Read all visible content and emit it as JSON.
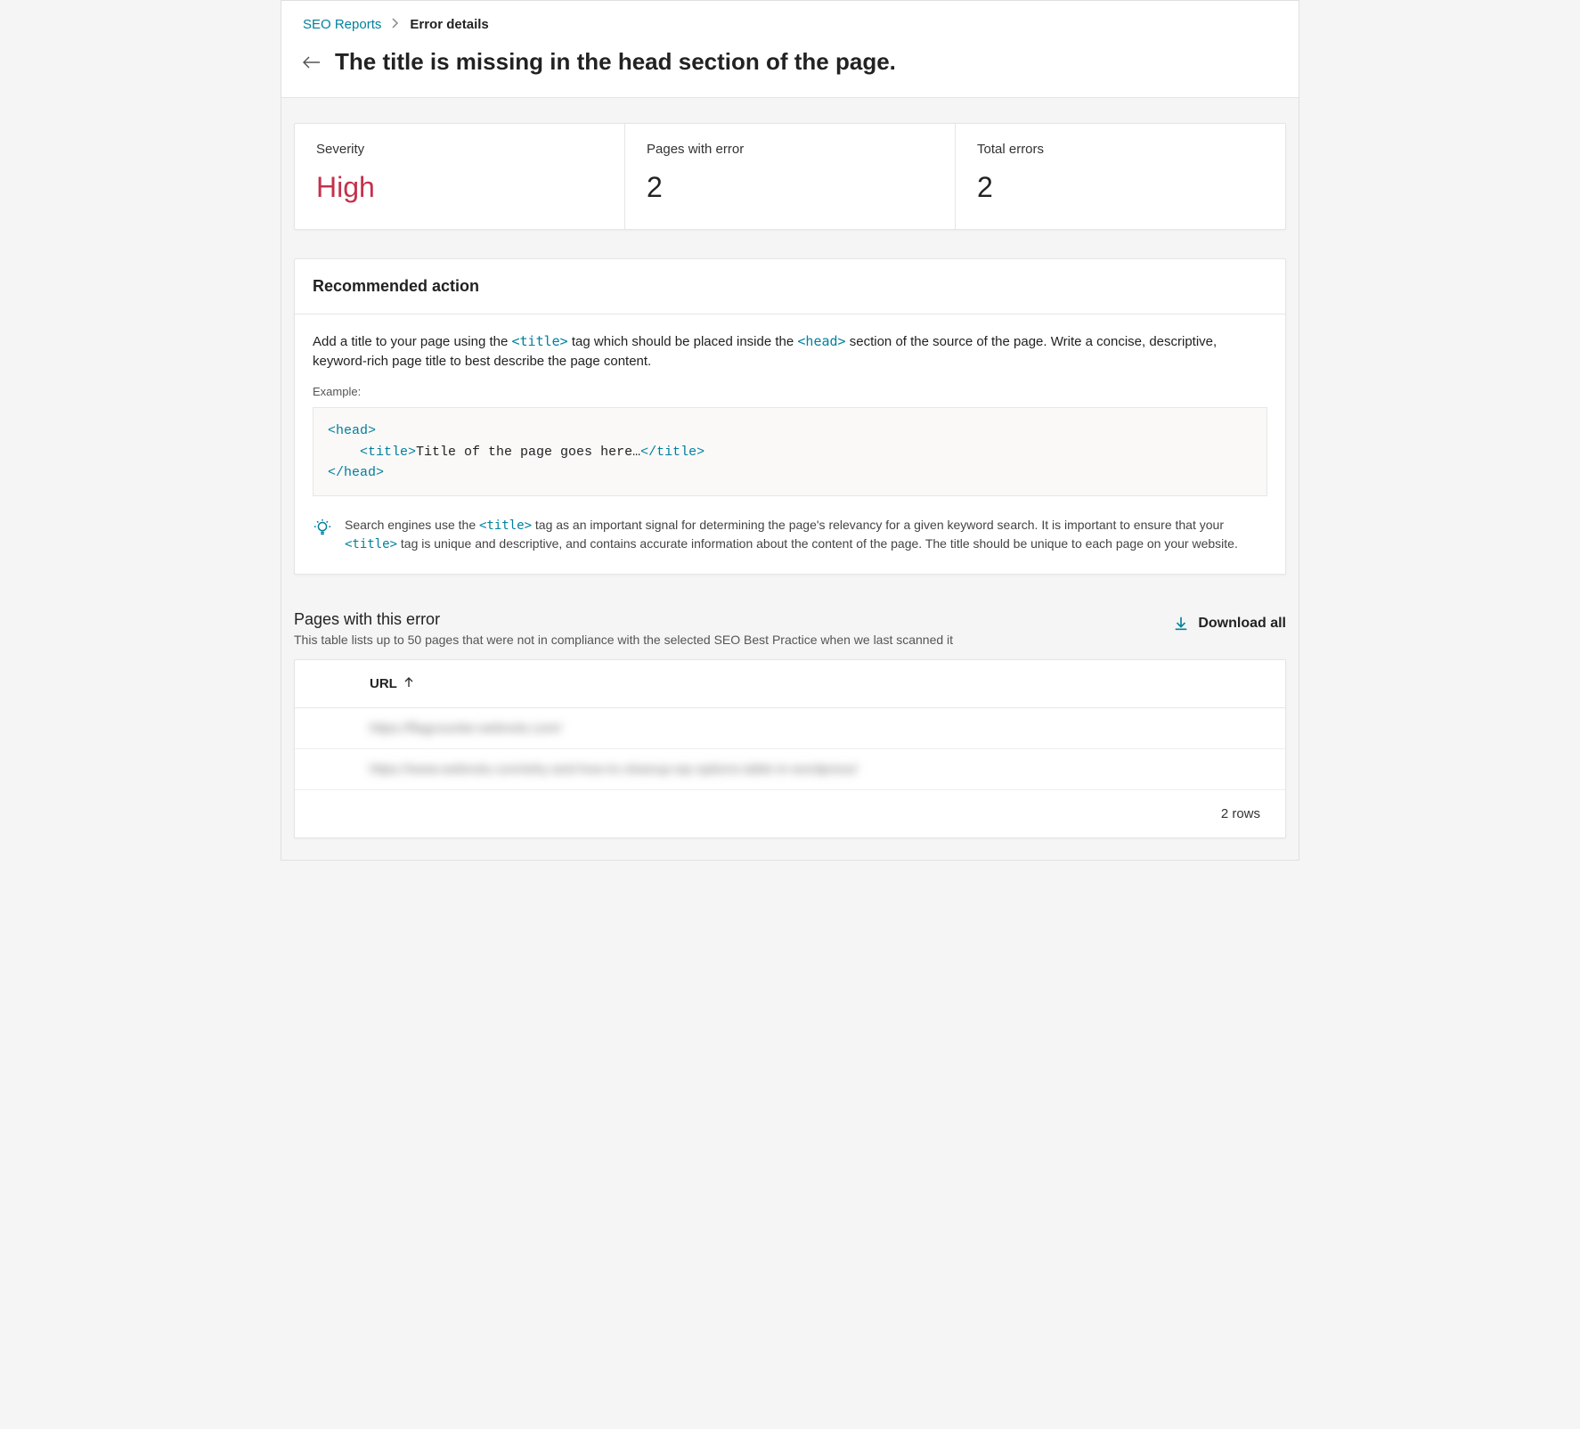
{
  "breadcrumb": {
    "link": "SEO Reports",
    "current": "Error details"
  },
  "page_title": "The title is missing in the head section of the page.",
  "stats": {
    "severity_label": "Severity",
    "severity_value": "High",
    "pages_label": "Pages with error",
    "pages_value": "2",
    "errors_label": "Total errors",
    "errors_value": "2"
  },
  "recommended": {
    "heading": "Recommended action",
    "desc_1": "Add a title to your page using the ",
    "desc_tag1": "<title>",
    "desc_2": " tag which should be placed inside the ",
    "desc_tag2": "<head>",
    "desc_3": " section of the source of the page. Write a concise, descriptive, keyword-rich page title to best describe the page content.",
    "example_label": "Example:",
    "code": {
      "l1": "<head>",
      "l2a": "    <title>",
      "l2b": "Title of the page goes here…",
      "l2c": "</title>",
      "l3": "</head>"
    },
    "tip_1": "Search engines use the ",
    "tip_tag1": "<title>",
    "tip_2": " tag as an important signal for determining the page's relevancy for a given keyword search. It is important to ensure that your ",
    "tip_tag2": "<title>",
    "tip_3": " tag is unique and descriptive, and contains accurate information about the content of the page. The title should be unique to each page on your website."
  },
  "pages_list": {
    "title": "Pages with this error",
    "subtitle": "This table lists up to 50 pages that were not in compliance with the selected SEO Best Practice when we last scanned it",
    "download_label": "Download all",
    "col_url": "URL",
    "rows": [
      "https://flagcounter.webnots.com/",
      "https://www.webnots.com/why-and-how-to-cleanup-wp-options-table-in-wordpress/"
    ],
    "footer": "2 rows"
  }
}
